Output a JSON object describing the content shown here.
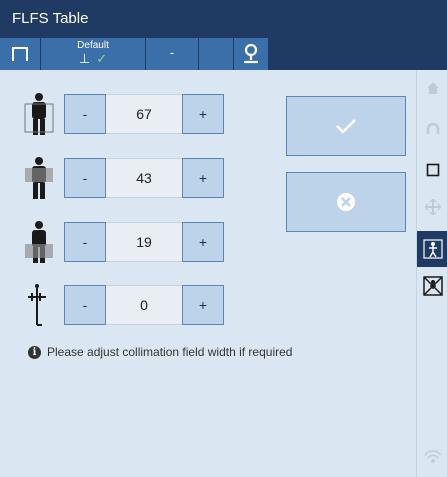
{
  "app": {
    "title": "FLFS Table"
  },
  "tabs": [
    {
      "icon": "table-icon"
    },
    {
      "label": "Default",
      "icon": "table-height-check-icon"
    },
    {
      "label": "-"
    },
    {
      "icon": "blank"
    },
    {
      "icon": "location-pin-icon"
    }
  ],
  "controls": [
    {
      "icon": "person-full-body-icon",
      "minus": "-",
      "value": "67",
      "plus": "+"
    },
    {
      "icon": "person-upper-body-icon",
      "minus": "-",
      "value": "43",
      "plus": "+"
    },
    {
      "icon": "person-lower-body-icon",
      "minus": "-",
      "value": "19",
      "plus": "+"
    },
    {
      "icon": "needle-column-icon",
      "minus": "-",
      "value": "0",
      "plus": "+"
    }
  ],
  "actions": {
    "confirm_icon": "checkmark-icon",
    "cancel_icon": "close-circle-icon"
  },
  "info": {
    "icon": "info-icon",
    "text": "Please adjust collimation field width if required"
  },
  "sidebar": [
    {
      "icon": "home-icon",
      "active": false
    },
    {
      "icon": "magnet-icon",
      "active": false
    },
    {
      "icon": "square-icon",
      "active": false
    },
    {
      "icon": "move-cross-icon",
      "active": false
    },
    {
      "icon": "body-scan-icon",
      "active": true
    },
    {
      "icon": "no-scatter-icon",
      "active": false
    },
    {
      "icon": "wireless-icon",
      "active": false
    }
  ],
  "colors": {
    "header": "#1f3b63",
    "tab": "#3b6fa9",
    "background": "#dbe6f3",
    "button": "#bcd3ea",
    "button_border": "#5b87b8",
    "check": "#7fe07f"
  }
}
